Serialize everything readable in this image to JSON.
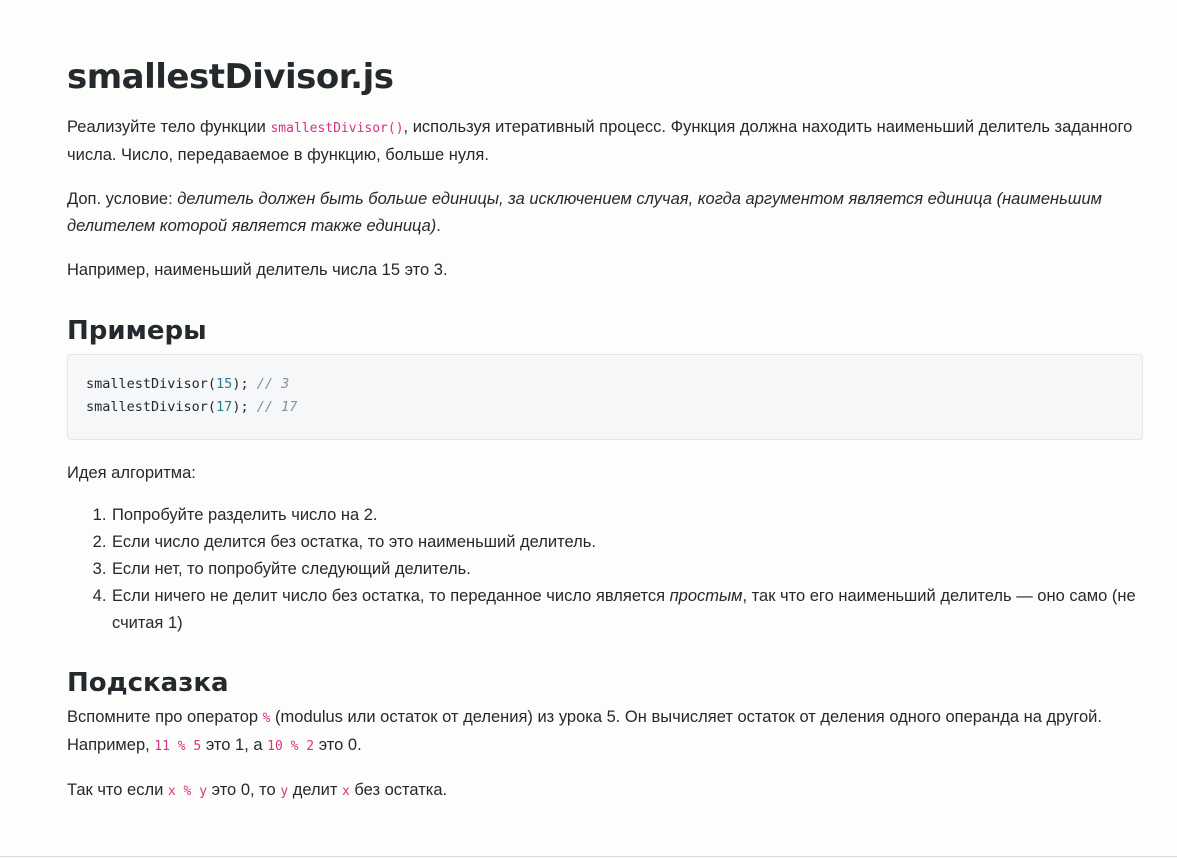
{
  "title": "smallestDivisor.js",
  "intro": {
    "text_before": "Реализуйте тело функции ",
    "code": "smallestDivisor()",
    "text_after": ", используя итеративный процесс. Функция должна находить наименьший делитель заданного числа. Число, передаваемое в функцию, больше нуля."
  },
  "condition": {
    "label": "Доп. условие: ",
    "italic": "делитель должен быть больше единицы, за исключением случая, когда аргументом является единица (наименьшим делителем которой является также единица)",
    "end": "."
  },
  "example_text": "Например, наименьший делитель числа 15 это 3.",
  "examples_heading": "Примеры",
  "code_examples": [
    {
      "fn": "smallestDivisor(",
      "arg": "15",
      "close": ");",
      "comment": "// 3"
    },
    {
      "fn": "smallestDivisor(",
      "arg": "17",
      "close": ");",
      "comment": "// 17"
    }
  ],
  "idea_label": "Идея алгоритма:",
  "steps": {
    "s1": "Попробуйте разделить число на 2.",
    "s2": "Если число делится без остатка, то это наименьший делитель.",
    "s3": "Если нет, то попробуйте следующий делитель.",
    "s4_before": "Если ничего не делит число без остатка, то переданное число является ",
    "s4_italic": "простым",
    "s4_after": ", так что его наименьший делитель — оно само (не считая 1)"
  },
  "hint_heading": "Подсказка",
  "hint": {
    "t1": "Вспомните про оператор ",
    "c1": "%",
    "t2": " (modulus или остаток от деления) из урока 5. Он вычисляет остаток от деления одного операнда на другой. Например, ",
    "c2": "11 % 5",
    "t3": " это 1, а ",
    "c3": "10 % 2",
    "t4": " это 0."
  },
  "hint2": {
    "t1": "Так что если ",
    "c1": "x % y",
    "t2": " это 0, то ",
    "c2": "y",
    "t3": " делит ",
    "c3": "x",
    "t4": " без остатка."
  },
  "colors": {
    "text": "#24292e",
    "inline_code": "#d63384",
    "number": "#1f7f8f",
    "comment": "#8a8f94",
    "code_bg": "#f6f7f8"
  }
}
